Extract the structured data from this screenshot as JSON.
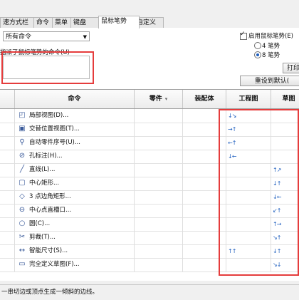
{
  "tabs": [
    {
      "label": "速方式栏",
      "active": false
    },
    {
      "label": "命令",
      "active": false
    },
    {
      "label": "菜单",
      "active": false
    },
    {
      "label": "键盘",
      "active": false
    },
    {
      "label": "鼠标笔势",
      "active": true
    },
    {
      "label": "自定义",
      "active": false
    }
  ],
  "filter": {
    "selected": "所有命令"
  },
  "gesture_label": "指派了鼠标笔势的命令(U)",
  "options": {
    "enable_label": "启用鼠标笔势(E)",
    "enable_checked": true,
    "four_label": "4 笔势",
    "eight_label": "8 笔势",
    "selected": "8"
  },
  "buttons": {
    "print": "打印",
    "reset": "重设到默认("
  },
  "table": {
    "headers": [
      "命令",
      "零件",
      "装配体",
      "工程图",
      "草图"
    ],
    "rows": [
      {
        "name": "局部视图(D)...",
        "icon": "detail-view-icon",
        "gestures": {
          "drawing": "↓↘"
        }
      },
      {
        "name": "交替位置视图(T)...",
        "icon": "alternate-position-view-icon",
        "gestures": {
          "drawing": "→↑"
        }
      },
      {
        "name": "自动零件序号(U)...",
        "icon": "auto-balloon-icon",
        "gestures": {
          "drawing": "←↑"
        }
      },
      {
        "name": "孔标注(H)...",
        "icon": "hole-callout-icon",
        "gestures": {
          "drawing": "↓←"
        }
      },
      {
        "name": "直线(L)...",
        "icon": "line-icon",
        "gestures": {
          "sketch": "↑↗"
        }
      },
      {
        "name": "中心矩形...",
        "icon": "center-rectangle-icon",
        "gestures": {
          "sketch": "↓↑"
        }
      },
      {
        "name": "3 点边角矩形...",
        "icon": "three-point-corner-rectangle-icon",
        "gestures": {
          "sketch": "↓←"
        }
      },
      {
        "name": "中心点直槽口...",
        "icon": "centerpoint-slot-icon",
        "gestures": {
          "sketch": "↙↑"
        }
      },
      {
        "name": "圆(C)...",
        "icon": "circle-icon",
        "gestures": {
          "sketch": "↑→"
        }
      },
      {
        "name": "剪裁(T)...",
        "icon": "trim-icon",
        "gestures": {
          "sketch": "↘↑"
        }
      },
      {
        "name": "智能尺寸(S)...",
        "icon": "smart-dimension-icon",
        "gestures": {
          "drawing": "↑↑",
          "sketch": "↓↑"
        }
      },
      {
        "name": "完全定义草图(F)...",
        "icon": "fully-define-sketch-icon",
        "gestures": {
          "sketch": "↘↓"
        }
      }
    ]
  },
  "status": "一串切边或顶点生成一倾斜的边线。",
  "colors": {
    "highlight": "#e53c3c",
    "gesture": "#1f5fbf",
    "selected_tab": "#ffffff"
  }
}
